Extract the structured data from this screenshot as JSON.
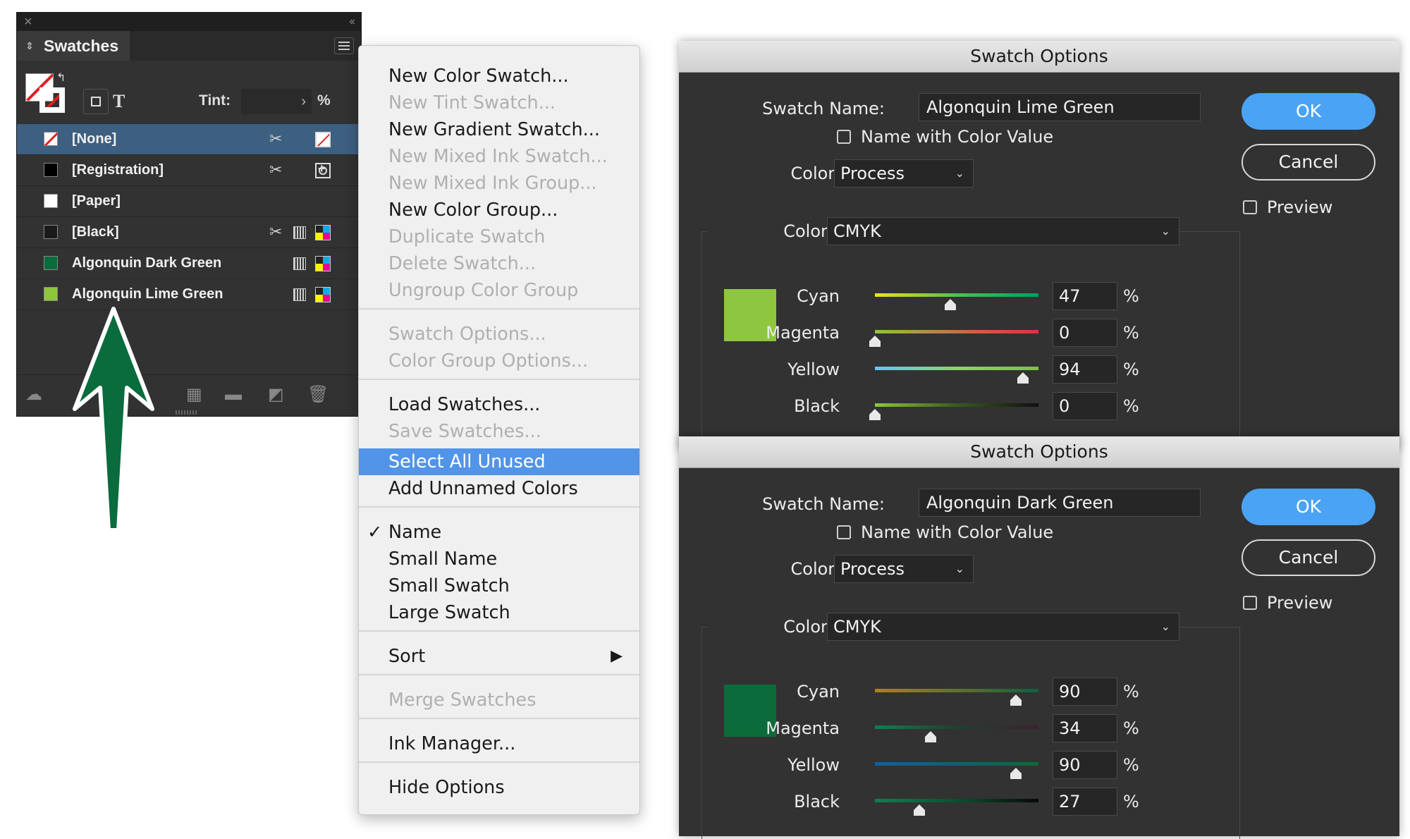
{
  "swatches_panel": {
    "tab_label": "Swatches",
    "close_glyph": "×",
    "collapse_glyph": "‹‹",
    "tint_label": "Tint:",
    "tint_value": "",
    "tint_unit": "%",
    "text_mode_glyph": "T",
    "swatches": [
      {
        "name": "[None]",
        "color": "none",
        "selected": true
      },
      {
        "name": "[Registration]",
        "color": "#000000",
        "selected": false
      },
      {
        "name": "[Paper]",
        "color": "#ffffff",
        "selected": false
      },
      {
        "name": "[Black]",
        "color": "#1a1a1a",
        "selected": false
      },
      {
        "name": "Algonquin Dark Green",
        "color": "#0b6b3a",
        "selected": false
      },
      {
        "name": "Algonquin Lime Green",
        "color": "#8dc63f",
        "selected": false
      }
    ],
    "annotation_arrow_color": "#0a6b3c"
  },
  "flyout_menu": {
    "items": [
      {
        "label": "New Color Swatch...",
        "enabled": true
      },
      {
        "label": "New Tint Swatch...",
        "enabled": false
      },
      {
        "label": "New Gradient Swatch...",
        "enabled": true
      },
      {
        "label": "New Mixed Ink Swatch...",
        "enabled": false
      },
      {
        "label": "New Mixed Ink Group...",
        "enabled": false
      },
      {
        "label": "New Color Group...",
        "enabled": true
      },
      {
        "label": "Duplicate Swatch",
        "enabled": false
      },
      {
        "label": "Delete Swatch...",
        "enabled": false
      },
      {
        "label": "Ungroup Color Group",
        "enabled": false
      },
      {
        "label": "Swatch Options...",
        "enabled": false
      },
      {
        "label": "Color Group Options...",
        "enabled": false
      },
      {
        "label": "Load Swatches...",
        "enabled": true
      },
      {
        "label": "Save Swatches...",
        "enabled": false
      },
      {
        "label": "Select All Unused",
        "enabled": true,
        "highlighted": true
      },
      {
        "label": "Add Unnamed Colors",
        "enabled": true
      },
      {
        "label": "Name",
        "enabled": true,
        "checked": true
      },
      {
        "label": "Small Name",
        "enabled": true
      },
      {
        "label": "Small Swatch",
        "enabled": true
      },
      {
        "label": "Large Swatch",
        "enabled": true
      },
      {
        "label": "Sort",
        "enabled": true,
        "submenu": true
      },
      {
        "label": "Merge Swatches",
        "enabled": false
      },
      {
        "label": "Ink Manager...",
        "enabled": true
      },
      {
        "label": "Hide Options",
        "enabled": true
      }
    ],
    "check_glyph": "✓",
    "submenu_glyph": "▶"
  },
  "dialogs": [
    {
      "title": "Swatch Options",
      "swatch_name_label": "Swatch Name:",
      "swatch_name": "Algonquin Lime Green",
      "name_with_value_label": "Name with Color Value",
      "color_type_label": "Color Type:",
      "color_type": "Process",
      "color_mode_label": "Color Mode:",
      "color_mode": "CMYK",
      "ok_label": "OK",
      "cancel_label": "Cancel",
      "preview_label": "Preview",
      "swatch_color": "#8dc63f",
      "channels": [
        {
          "label": "Cyan",
          "value": "47",
          "unit": "%"
        },
        {
          "label": "Magenta",
          "value": "0",
          "unit": "%"
        },
        {
          "label": "Yellow",
          "value": "94",
          "unit": "%"
        },
        {
          "label": "Black",
          "value": "0",
          "unit": "%"
        }
      ]
    },
    {
      "title": "Swatch Options",
      "swatch_name_label": "Swatch Name:",
      "swatch_name": "Algonquin Dark Green",
      "name_with_value_label": "Name with Color Value",
      "color_type_label": "Color Type:",
      "color_type": "Process",
      "color_mode_label": "Color Mode:",
      "color_mode": "CMYK",
      "ok_label": "OK",
      "cancel_label": "Cancel",
      "preview_label": "Preview",
      "swatch_color": "#0b6b3a",
      "channels": [
        {
          "label": "Cyan",
          "value": "90",
          "unit": "%"
        },
        {
          "label": "Magenta",
          "value": "34",
          "unit": "%"
        },
        {
          "label": "Yellow",
          "value": "90",
          "unit": "%"
        },
        {
          "label": "Black",
          "value": "27",
          "unit": "%"
        }
      ]
    }
  ]
}
